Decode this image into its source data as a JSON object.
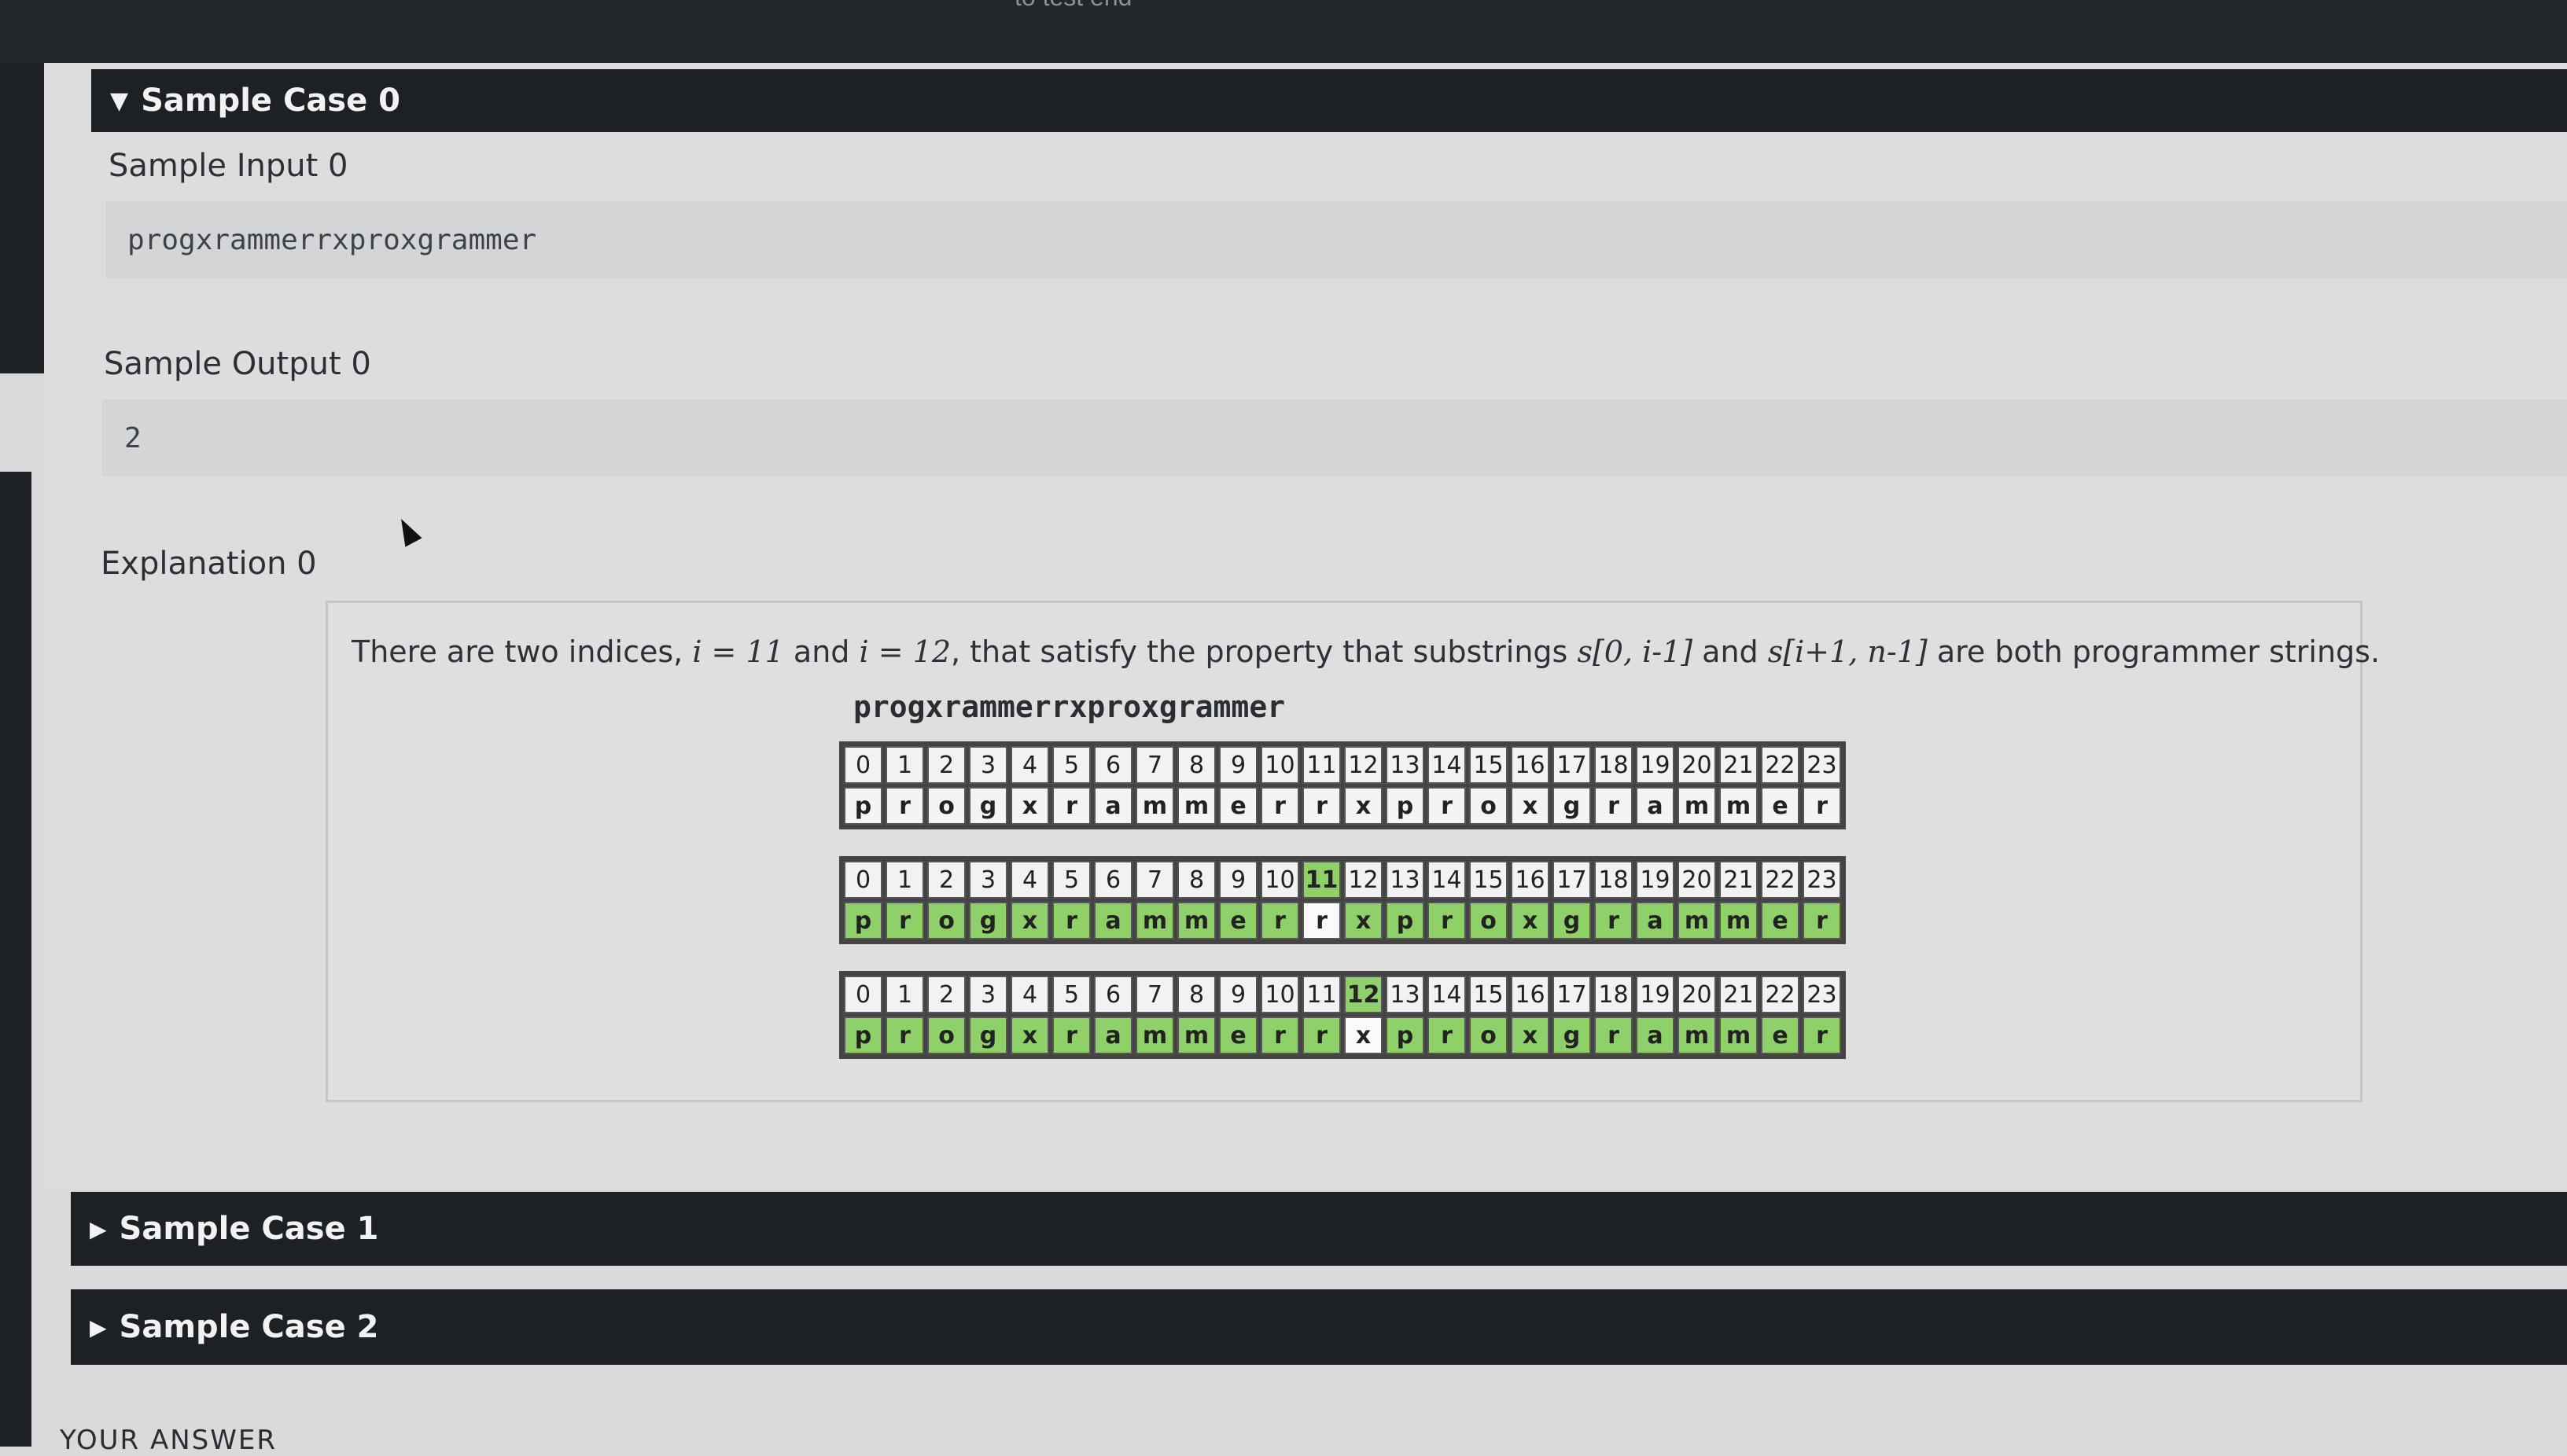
{
  "top_partial_text": "to test end",
  "sample_case_0": {
    "header": "Sample Case 0",
    "input_label": "Sample Input 0",
    "input_value": "progxrammerrxproxgrammer",
    "output_label": "Sample Output 0",
    "output_value": "2",
    "explanation_label": "Explanation 0",
    "explanation": {
      "p1": "There are two indices, ",
      "i1": "i = 11",
      "p2": " and ",
      "i2": "i = 12",
      "p3": ", that satisfy the property that substrings ",
      "i3": "s[0, i-1]",
      "p4": " and ",
      "i4": "s[i+1, n-1]",
      "p5": " are both programmer strings."
    },
    "diagram_title": "progxrammerrxproxgrammer",
    "indices": [
      "0",
      "1",
      "2",
      "3",
      "4",
      "5",
      "6",
      "7",
      "8",
      "9",
      "10",
      "11",
      "12",
      "13",
      "14",
      "15",
      "16",
      "17",
      "18",
      "19",
      "20",
      "21",
      "22",
      "23"
    ],
    "chars": [
      "p",
      "r",
      "o",
      "g",
      "x",
      "r",
      "a",
      "m",
      "m",
      "e",
      "r",
      "r",
      "x",
      "p",
      "r",
      "o",
      "x",
      "g",
      "r",
      "a",
      "m",
      "m",
      "e",
      "r"
    ],
    "highlight_grids": [
      {
        "split_index": 11,
        "exclude_index": 11
      },
      {
        "split_index": 12,
        "exclude_index": 12
      }
    ],
    "colors": {
      "green": "#8fd069"
    }
  },
  "sample_case_1": {
    "header": "Sample Case 1"
  },
  "sample_case_2": {
    "header": "Sample Case 2"
  },
  "bottom_partial_text": "YOUR ANSWER"
}
